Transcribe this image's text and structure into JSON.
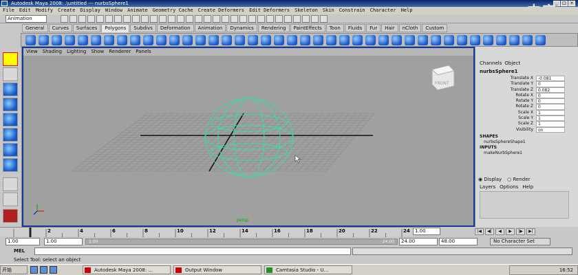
{
  "window": {
    "title": "Autodesk Maya 2008: .\\untitled  ---  nurbsSphere1",
    "watermark": "..."
  },
  "menubar": [
    "File",
    "Edit",
    "Modify",
    "Create",
    "Display",
    "Window",
    "Animate",
    "Geometry Cache",
    "Create Deformers",
    "Edit Deformers",
    "Skeleton",
    "Skin",
    "Constrain",
    "Character",
    "Help"
  ],
  "statusline": {
    "mode": "Animation"
  },
  "shelf_tabs": [
    "General",
    "Curves",
    "Surfaces",
    "Polygons",
    "Subdivs",
    "Deformation",
    "Animation",
    "Dynamics",
    "Rendering",
    "PaintEffects",
    "Toon",
    "Fluids",
    "Fur",
    "Hair",
    "nCloth",
    "Custom"
  ],
  "shelf_active_tab": "Polygons",
  "panel_menu": [
    "View",
    "Shading",
    "Lighting",
    "Show",
    "Renderer",
    "Panels"
  ],
  "viewport": {
    "camera": "persp",
    "viewcube_label": "FRONT",
    "object": "nurbsSphere1",
    "wireframe_color": "#33e0a0"
  },
  "channel_box": {
    "tabs": [
      "Channels",
      "Object"
    ],
    "object": "nurbsSphere1",
    "attributes": [
      {
        "name": "Translate X",
        "value": "-0.081"
      },
      {
        "name": "Translate Y",
        "value": "0"
      },
      {
        "name": "Translate Z",
        "value": "0.082"
      },
      {
        "name": "Rotate X",
        "value": "0"
      },
      {
        "name": "Rotate Y",
        "value": "0"
      },
      {
        "name": "Rotate Z",
        "value": "0"
      },
      {
        "name": "Scale X",
        "value": "1"
      },
      {
        "name": "Scale Y",
        "value": "1"
      },
      {
        "name": "Scale Z",
        "value": "1"
      },
      {
        "name": "Visibility",
        "value": "on"
      }
    ],
    "shapes_header": "SHAPES",
    "shape": "nurbsSphereShape1",
    "inputs_header": "INPUTS",
    "input": "makeNurbSphere1",
    "display_options": [
      "Display",
      "Render"
    ],
    "layer_menu": [
      "Layers",
      "Options",
      "Help"
    ]
  },
  "timeline": {
    "ticks": [
      "2",
      "4",
      "6",
      "8",
      "10",
      "12",
      "14",
      "16",
      "18",
      "20",
      "22",
      "24"
    ],
    "current_time": "1.00"
  },
  "range": {
    "start": "1.00",
    "start2": "1.00",
    "bar_left": "1.00",
    "bar_right": "24.00",
    "end": "24.00",
    "end2": "48.00",
    "character_set": "No Character Set"
  },
  "cmdline": {
    "label": "MEL"
  },
  "helpline": "Select Tool: select an object",
  "taskbar": {
    "start": "开始",
    "tasks": [
      "Autodesk Maya 2008: ...",
      "Output Window",
      "Camtasia Studio - U..."
    ],
    "clock": "16:52"
  }
}
